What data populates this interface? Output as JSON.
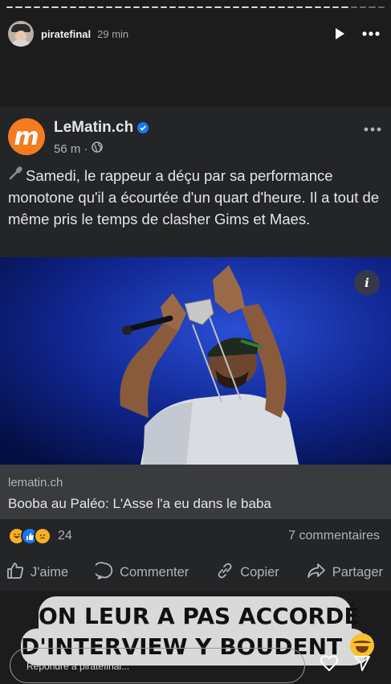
{
  "story": {
    "progress_segments": 42,
    "progress_done": 38,
    "username": "piratefinal",
    "time": "29 min"
  },
  "post": {
    "page_name": "LeMatin.ch",
    "logo_letter": "m",
    "time": "56 m ·",
    "text": "Samedi, le rappeur a déçu par sa performance monotone qu'il a écourtée d'un quart d'heure. Il a tout de même pris le temps de clasher Gims et Maes.",
    "link_domain": "lematin.ch",
    "link_title": "Booba au Paléo: L'Asse l'a eu dans le baba",
    "reaction_count": "24",
    "comments": "7 commentaires",
    "actions": {
      "like": "J'aime",
      "comment": "Commenter",
      "copy": "Copier",
      "share": "Partager"
    }
  },
  "sticker": {
    "line1": "ON LEUR A PAS ACCORDÉ",
    "line2": "D'INTERVIEW Y BOUDENT"
  },
  "reply": {
    "placeholder": "Répondre à piratefinal..."
  },
  "colors": {
    "background": "#1c1c1c",
    "card": "#242526",
    "link_box": "#3a3b3c",
    "brand_orange": "#f47b20",
    "facebook_blue": "#1877f2",
    "sticker_bg": "#d9d9d9"
  }
}
